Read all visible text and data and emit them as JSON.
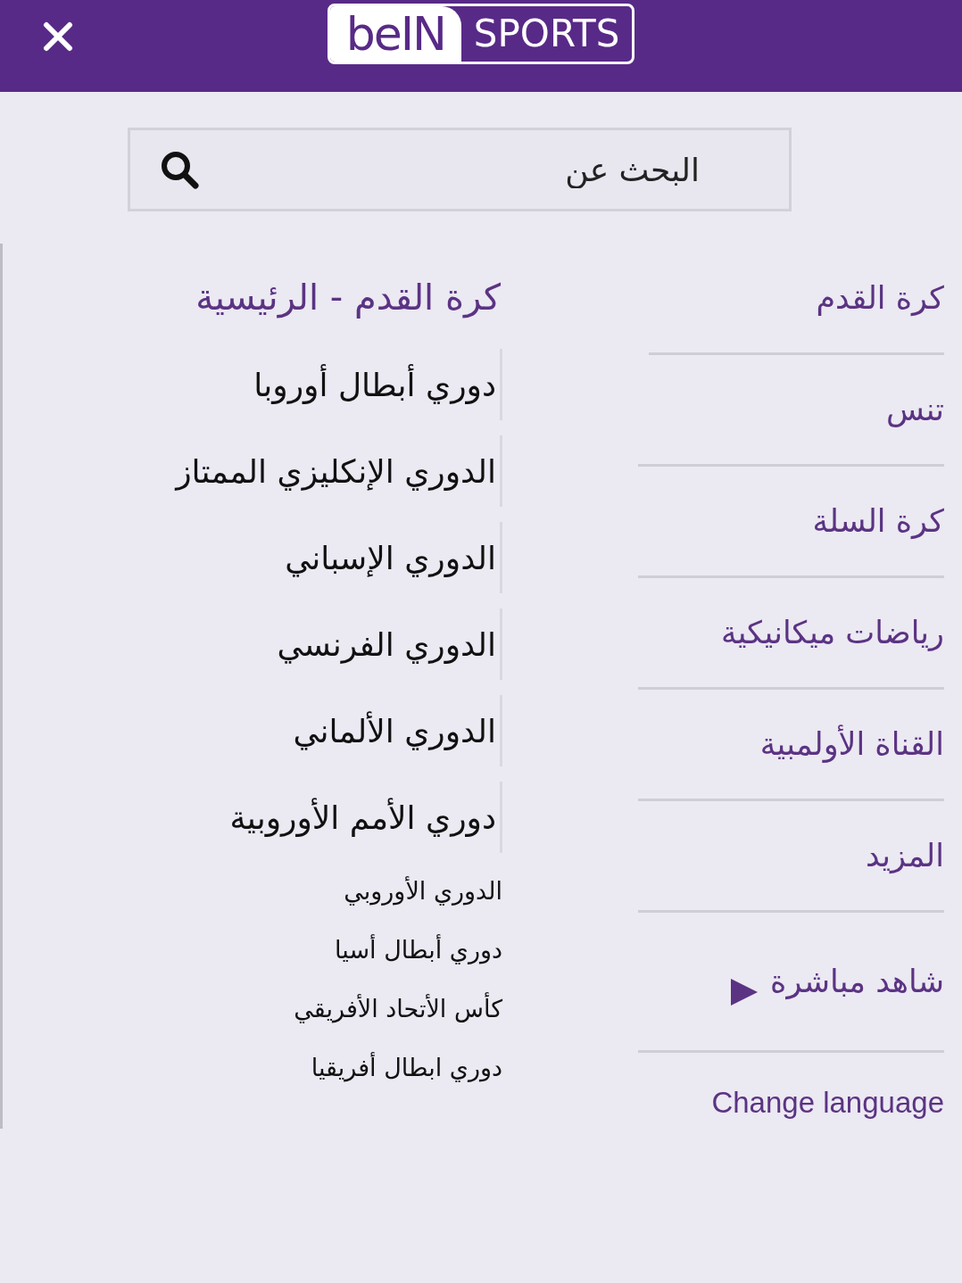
{
  "logo": {
    "brand": "beIN",
    "product": "SPORTS"
  },
  "search": {
    "placeholder": "البحث عن"
  },
  "submenu": {
    "title": "كرة القدم - الرئيسية",
    "items": [
      {
        "label": "دوري أبطال أوروبا",
        "kind": "major"
      },
      {
        "label": "الدوري الإنكليزي الممتاز",
        "kind": "major"
      },
      {
        "label": "الدوري الإسباني",
        "kind": "major"
      },
      {
        "label": "الدوري الفرنسي",
        "kind": "major"
      },
      {
        "label": "الدوري الألماني",
        "kind": "major"
      },
      {
        "label": "دوري الأمم الأوروبية",
        "kind": "major"
      },
      {
        "label": "الدوري الأوروبي",
        "kind": "minor"
      },
      {
        "label": "دوري أبطال أسيا",
        "kind": "minor"
      },
      {
        "label": "كأس الأتحاد الأفريقي",
        "kind": "minor"
      },
      {
        "label": "دوري ابطال أفريقيا",
        "kind": "minor"
      }
    ]
  },
  "menu": {
    "items": [
      {
        "label": "كرة القدم",
        "kind": "category"
      },
      {
        "label": "تنس",
        "kind": "category"
      },
      {
        "label": "كرة السلة",
        "kind": "category"
      },
      {
        "label": "رياضات ميكانيكية",
        "kind": "category"
      },
      {
        "label": "القناة الأولمبية",
        "kind": "category"
      },
      {
        "label": "المزيد",
        "kind": "category"
      },
      {
        "label": "شاهد مباشرة",
        "kind": "expandable"
      },
      {
        "label": "Change language",
        "kind": "language"
      }
    ]
  }
}
